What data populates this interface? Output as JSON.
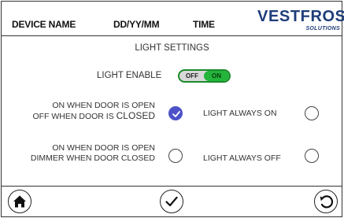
{
  "header": {
    "device_name": "DEVICE NAME",
    "date_format": "DD/YY/MM",
    "time": "TIME",
    "logo_main": "VESTFROST",
    "logo_sub": "SOLUTIONS"
  },
  "title": "LIGHT SETTINGS",
  "light_enable": {
    "label": "LIGHT ENABLE",
    "off_label": "OFF",
    "on_label": "ON",
    "state": "ON"
  },
  "options": {
    "door_open_closed": {
      "line1": "ON WHEN DOOR IS OPEN",
      "line2a": "OFF WHEN DOOR IS ",
      "line2b": "CLOSED",
      "selected": true
    },
    "always_on": {
      "label": "LIGHT ALWAYS ON",
      "selected": false
    },
    "dimmer": {
      "line1": "ON WHEN DOOR IS OPEN",
      "line2": "DIMMER WHEN DOOR CLOSED",
      "selected": false
    },
    "always_off": {
      "label": "LIGHT ALWAYS OFF",
      "selected": false
    }
  },
  "footer": {
    "home_icon": "home-icon",
    "confirm_icon": "checkmark-icon",
    "back_icon": "back-arrow-icon"
  },
  "colors": {
    "brand": "#1f3d7a",
    "toggle_on": "#22b53a",
    "radio_selected": "#4d52c9"
  }
}
